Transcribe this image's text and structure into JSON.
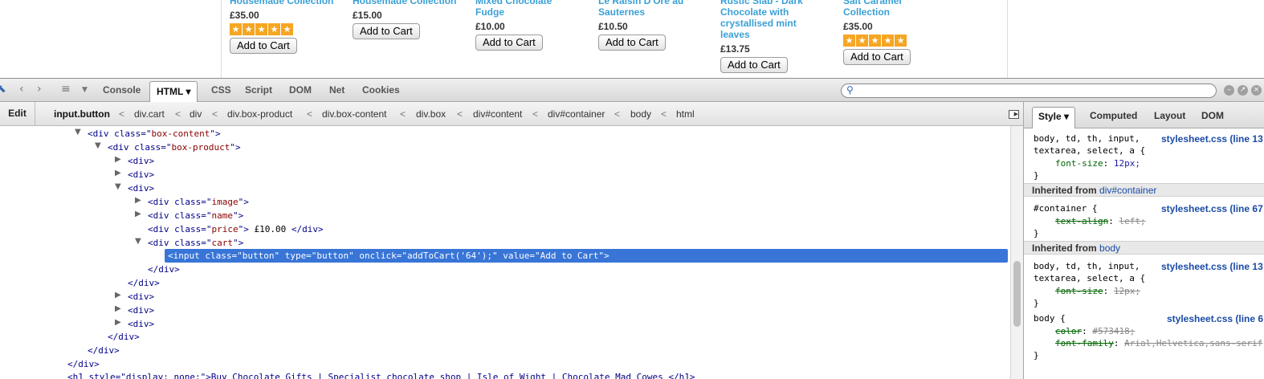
{
  "products": [
    {
      "name": [
        "Housemade Collection"
      ],
      "price": "£35.00",
      "rating": 5,
      "button": "Add to Cart"
    },
    {
      "name": [
        "Housemade Collection"
      ],
      "price": "£15.00",
      "rating": 0,
      "button": "Add to Cart"
    },
    {
      "name": [
        "Mixed Chocolate",
        "Fudge"
      ],
      "price": "£10.00",
      "rating": 0,
      "button": "Add to Cart"
    },
    {
      "name": [
        "Le Raisin D'Ore au",
        "Sauternes"
      ],
      "price": "£10.50",
      "rating": 0,
      "button": "Add to Cart"
    },
    {
      "name": [
        "Rustic Slab - Dark",
        "Chocolate with",
        "crystallised mint",
        "leaves"
      ],
      "price": "£13.75",
      "rating": 0,
      "button": "Add to Cart"
    },
    {
      "name": [
        "Salt Caramel",
        "Collection"
      ],
      "price": "£35.00",
      "rating": 5,
      "button": "Add to Cart"
    }
  ],
  "toolbar": {
    "tabs": [
      "Console",
      "HTML ▾",
      "CSS",
      "Script",
      "DOM",
      "Net",
      "Cookies"
    ],
    "active_tab": "HTML ▾"
  },
  "breadcrumb": {
    "edit_label": "Edit",
    "items": [
      "input.button",
      "div.cart",
      "div",
      "div.box-product",
      "div.box-content",
      "div.box",
      "div#content",
      "div#container",
      "body",
      "html"
    ],
    "separator": "<"
  },
  "tree": {
    "line1": {
      "open": "<div ",
      "attr": "class",
      "eq": "=\"",
      "val": "box-content",
      "close": "\">"
    },
    "line2": {
      "open": "<div ",
      "attr": "class",
      "eq": "=\"",
      "val": "box-product",
      "close": "\">"
    },
    "div_open": "<div>",
    "div_close": "</div>",
    "image_div": {
      "open": "<div ",
      "attr": "class",
      "eq": "=\"",
      "val": "image",
      "close": "\">"
    },
    "name_div": {
      "open": "<div ",
      "attr": "class",
      "eq": "=\"",
      "val": "name",
      "close": "\">"
    },
    "price_div": {
      "open": "<div ",
      "attr": "class",
      "eq": "=\"",
      "val": "price",
      "close": "\">",
      "text": " £10.00 ",
      "end": "</div>"
    },
    "cart_div": {
      "open": "<div ",
      "attr": "class",
      "eq": "=\"",
      "val": "cart",
      "close": "\">"
    },
    "selected": "<input class=\"button\" type=\"button\" onclick=\"addToCart('64');\" value=\"Add to Cart\">",
    "bottom_partial": "<h1 style=\"display: none;\">Buy Chocolate Gifts | Specialist chocolate shop | Isle of Wight | Chocolate Mad Cowes </h1>"
  },
  "side_panel": {
    "tabs": [
      "Style ▾",
      "Computed",
      "Layout",
      "DOM"
    ],
    "active_tab": "Style ▾",
    "rule1": {
      "selector1": "body, td, th, input,",
      "selector2": "textarea, select, a {",
      "source": "stylesheet.css (line 13",
      "prop": "font-size",
      "value": "12px;",
      "close": "}"
    },
    "inherited1": {
      "label": "Inherited from ",
      "selector": "div#container"
    },
    "rule2": {
      "selector": "#container {",
      "source": "stylesheet.css (line 67",
      "prop": "text-align",
      "value": "left;",
      "close": "}"
    },
    "inherited2": {
      "label": "Inherited from ",
      "selector": "body"
    },
    "rule3": {
      "selector1": "body, td, th, input,",
      "selector2": "textarea, select, a {",
      "source": "stylesheet.css (line 13",
      "prop": "font-size",
      "value": "12px;",
      "close": "}"
    },
    "rule4": {
      "selector": "body {",
      "source": "stylesheet.css (line 6",
      "prop1": "color",
      "value1": "#573418;",
      "prop2": "font-family",
      "value2": "Arial,Helvetica,sans-serif",
      "close": "}"
    }
  },
  "colors": {
    "link": "#3aa0d6",
    "star": "#f5a623",
    "selection": "#3875d7",
    "tag": "#000088",
    "attr_value": "#880000"
  }
}
